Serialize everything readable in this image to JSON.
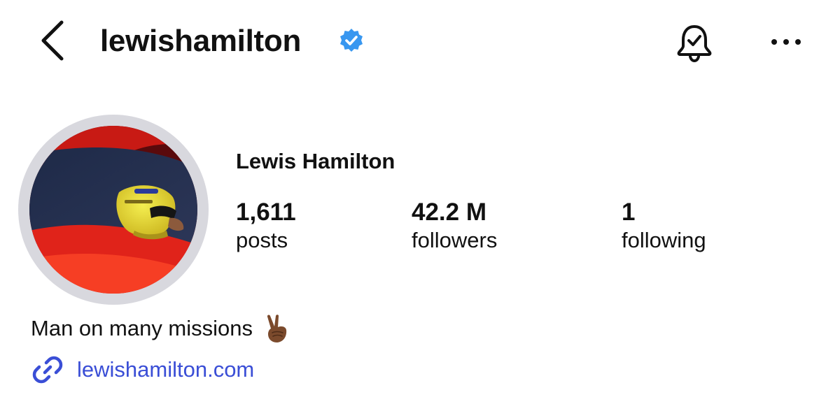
{
  "header": {
    "back_icon": "chevron-left-icon",
    "username": "lewishamilton",
    "verified_icon": "verified-badge-icon",
    "bell_icon": "bell-check-icon",
    "more_icon": "more-horizontal-icon"
  },
  "profile": {
    "avatar_icon": "avatar",
    "full_name": "Lewis Hamilton",
    "stats": [
      {
        "value": "1,611",
        "label": "posts"
      },
      {
        "value": "42.2 M",
        "label": "followers"
      },
      {
        "value": "1",
        "label": "following"
      }
    ],
    "bio": "Man on many missions",
    "bio_emoji_icon": "victory-hand-icon",
    "link_icon": "link-icon",
    "link_text": "lewishamilton.com"
  },
  "colors": {
    "text": "#111111",
    "link": "#3a4ed6",
    "verified_badge": "#3897f0",
    "avatar_ring": "#d8d8de"
  }
}
